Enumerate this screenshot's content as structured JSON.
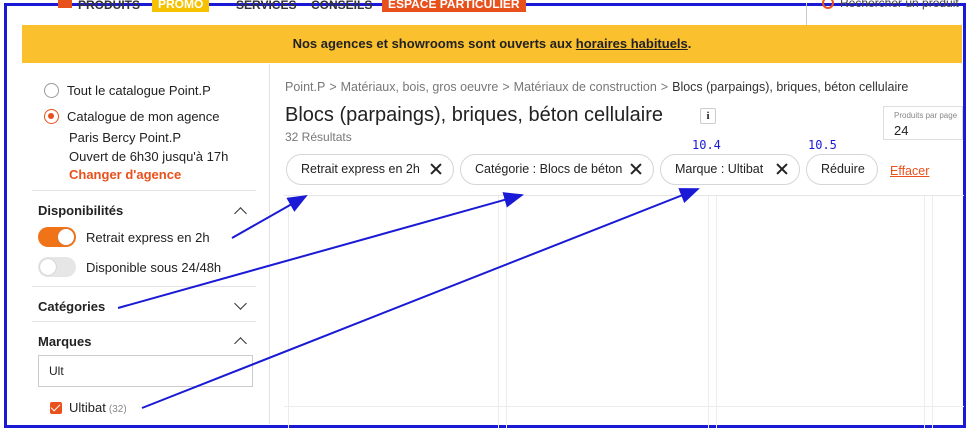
{
  "nav": {
    "produits": "PRODUITS",
    "promo": "PROMO",
    "services": "SERVICES",
    "conseils": "CONSEILS",
    "espace": "ESPACE PARTICULIER",
    "search_placeholder": "Rechercher un produit"
  },
  "banner": {
    "text_before": "Nos agences et showrooms sont ouverts aux ",
    "link": "horaires habituels",
    "text_after": "."
  },
  "sidebar": {
    "catalogue_all": "Tout le catalogue Point.P",
    "catalogue_agency": "Catalogue de mon agence",
    "agency_name": "Paris Bercy Point.P",
    "agency_hours": "Ouvert de 6h30 jusqu'à 17h",
    "change_agency": "Changer d'agence",
    "availability_title": "Disponibilités",
    "express_label": "Retrait express en 2h",
    "express_on": true,
    "available_label": "Disponible sous 24/48h",
    "available_on": false,
    "categories_title": "Catégories",
    "brands_title": "Marques",
    "brand_search_value": "Ult",
    "brand_item_label": "Ultibat",
    "brand_item_count": "(32)"
  },
  "main": {
    "breadcrumb": [
      "Point.P",
      "Matériaux, bois, gros oeuvre",
      "Matériaux de construction",
      "Blocs (parpaings), briques, béton cellulaire"
    ],
    "title": "Blocs (parpaings), briques, béton cellulaire",
    "info": "i",
    "results": "32 Résultats",
    "per_page_label": "Produits par page",
    "per_page_value": "24",
    "chips": [
      "Retrait express en 2h",
      "Catégorie : Blocs de béton",
      "Marque : Ultibat",
      "Réduire"
    ],
    "clear": "Effacer",
    "annotation_marque": "10.4",
    "annotation_reduire": "10.5"
  },
  "colors": {
    "accent": "#e8501c",
    "banner": "#fbc02d",
    "annotation": "#1a1ad6"
  }
}
